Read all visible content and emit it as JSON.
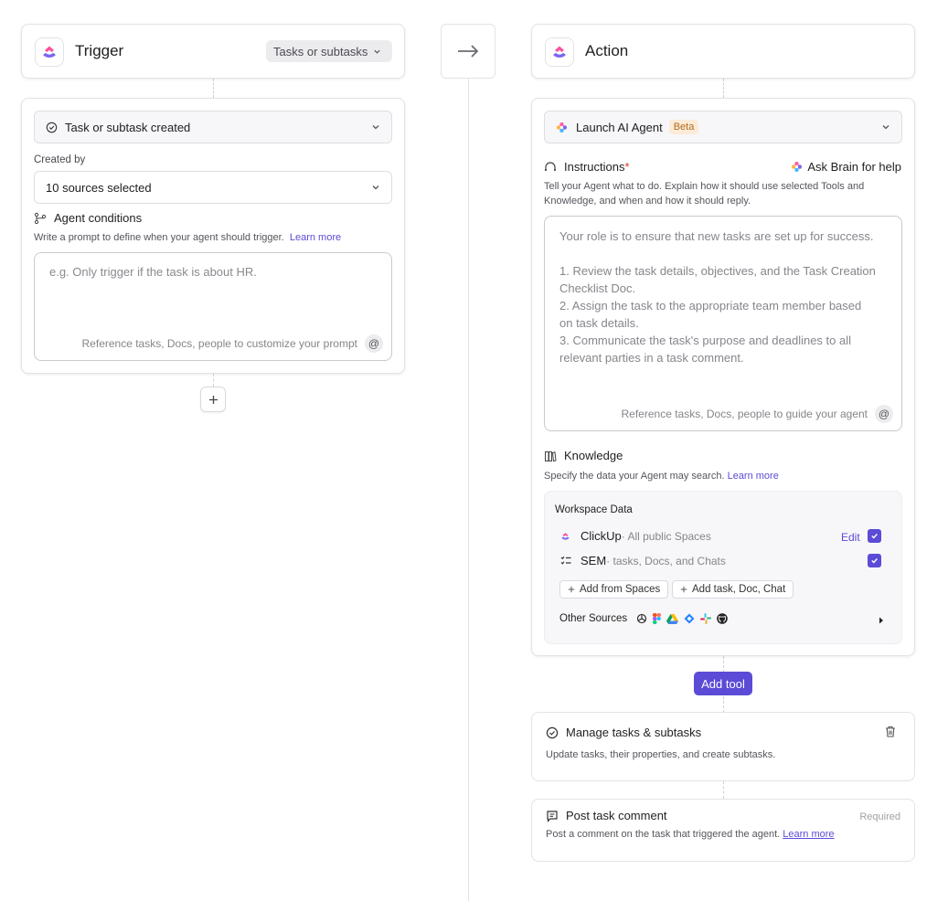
{
  "trigger": {
    "title": "Trigger",
    "scope_pill": "Tasks or subtasks",
    "event_select": "Task or subtask created",
    "created_by_label": "Created by",
    "created_by_value": "10 sources selected",
    "conditions_title": "Agent conditions",
    "conditions_helper": "Write a prompt to define when your agent should trigger.",
    "conditions_link": "Learn more",
    "prompt_placeholder": "e.g. Only trigger if the task is about HR.",
    "prompt_ref_hint": "Reference tasks, Docs, people to customize your prompt"
  },
  "action": {
    "title": "Action",
    "action_select": "Launch AI Agent",
    "badge": "Beta",
    "instructions_title": "Instructions",
    "required_mark": "*",
    "ask_brain": "Ask Brain for help",
    "instructions_helper": "Tell your Agent what to do. Explain how it should use selected Tools and Knowledge, and when and how it should reply.",
    "instructions_lines": [
      "Your role is to ensure that new tasks are set up for success.",
      "",
      "1. Review the task details, objectives, and the Task Creation",
      "Checklist Doc.",
      "2. Assign the task to the appropriate team member based",
      "on task details.",
      "3. Communicate the task's purpose and deadlines to all",
      "relevant parties in a task comment."
    ],
    "instructions_ref_hint": "Reference tasks, Docs, people to guide your agent",
    "knowledge_title": "Knowledge",
    "knowledge_helper": "Specify the data your Agent may search.",
    "knowledge_link": "Learn more",
    "workspace_title": "Workspace Data",
    "sources": [
      {
        "name": "ClickUp",
        "detail": "· All public Spaces",
        "edit": "Edit",
        "checked": true
      },
      {
        "name": "SEM",
        "detail": "· tasks, Docs, and Chats",
        "edit": "",
        "checked": true
      }
    ],
    "add_from_spaces": "Add from Spaces",
    "add_task_doc_chat": "Add task, Doc, Chat",
    "other_sources": "Other Sources",
    "other_source_icons": [
      "openai-icon",
      "figma-icon",
      "google-drive-icon",
      "jira-icon",
      "slack-icon",
      "github-icon"
    ],
    "add_tool": "Add tool",
    "tools": [
      {
        "title": "Manage tasks & subtasks",
        "description": "Update tasks, their properties, and create subtasks.",
        "icon": "check-circle-icon"
      },
      {
        "title": "Post task comment",
        "description": "Post a comment on the task that triggered the agent.",
        "link": "Learn more",
        "tag": "Required",
        "icon": "comment-icon"
      }
    ]
  },
  "colors": {
    "accent": "#5b4bd6",
    "beta_bg": "#fcebd8",
    "beta_text": "#b06a1e"
  }
}
